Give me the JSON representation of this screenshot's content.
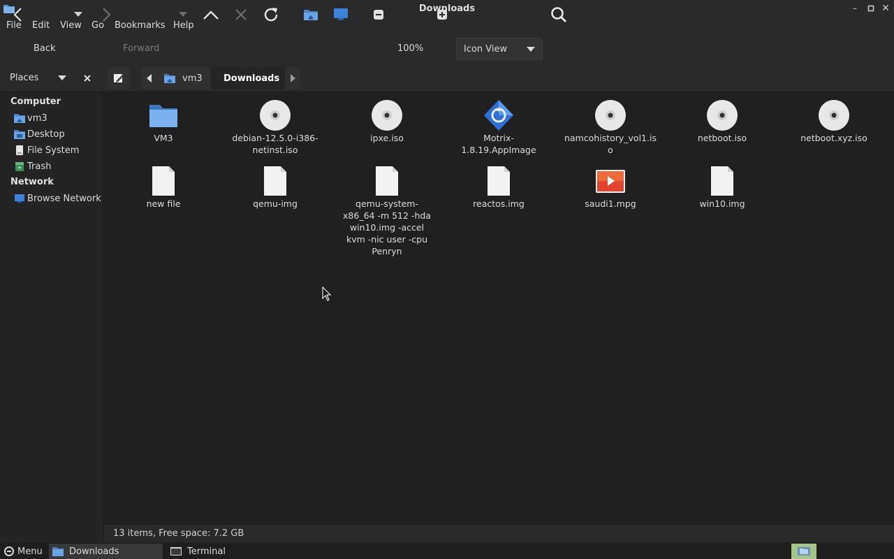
{
  "window": {
    "title": "Downloads"
  },
  "menubar": {
    "items": [
      "File",
      "Edit",
      "View",
      "Go",
      "Bookmarks",
      "Help"
    ]
  },
  "toolbar": {
    "back_label": "Back",
    "forward_label": "Forward",
    "zoom_level": "100%",
    "view_mode": "Icon View"
  },
  "places": {
    "title": "Places"
  },
  "breadcrumb": {
    "items": [
      "vm3",
      "Downloads"
    ]
  },
  "sidebar": {
    "sections": [
      {
        "title": "Computer",
        "items": [
          "vm3",
          "Desktop",
          "File System",
          "Trash"
        ]
      },
      {
        "title": "Network",
        "items": [
          "Browse Network"
        ]
      }
    ]
  },
  "files": [
    {
      "name": "VM3",
      "type": "folder"
    },
    {
      "name": "debian-12.5.0-i386-netinst.iso",
      "type": "disc"
    },
    {
      "name": "ipxe.iso",
      "type": "disc"
    },
    {
      "name": "Motrix-1.8.19.AppImage",
      "type": "appimage"
    },
    {
      "name": "namcohistory_vol1.iso",
      "type": "disc"
    },
    {
      "name": "netboot.iso",
      "type": "disc"
    },
    {
      "name": "netboot.xyz.iso",
      "type": "disc"
    },
    {
      "name": "new file",
      "type": "blank"
    },
    {
      "name": "qemu-img",
      "type": "blank"
    },
    {
      "name": "qemu-system-x86_64 -m 512 -hda win10.img -accel kvm -nic user -cpu Penryn",
      "type": "blank"
    },
    {
      "name": "reactos.img",
      "type": "blank"
    },
    {
      "name": "saudi1.mpg",
      "type": "video"
    },
    {
      "name": "win10.img",
      "type": "blank"
    }
  ],
  "status": {
    "text": "13 items, Free space: 7.2 GB"
  },
  "taskbar": {
    "menu_label": "Menu",
    "tasks": [
      "Downloads",
      "Terminal"
    ]
  },
  "colors": {
    "accent_folder": "#4a90d9",
    "video": "#e2452f",
    "background": "#202020"
  }
}
